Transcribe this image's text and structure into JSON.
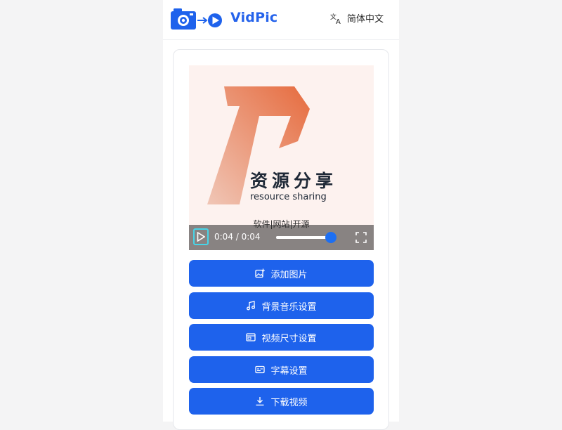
{
  "app": {
    "title": "VidPic",
    "language": "简体中文"
  },
  "video": {
    "brand_cn": "资源分享",
    "brand_en": "resource sharing",
    "brand_sub": "软件|网站|开源",
    "time_display": "0:04 / 0:04",
    "progress": 1.0
  },
  "actions": [
    {
      "label": "添加图片",
      "icon": "add-image-icon"
    },
    {
      "label": "背景音乐设置",
      "icon": "music-note-icon"
    },
    {
      "label": "视频尺寸设置",
      "icon": "aspect-ratio-icon"
    },
    {
      "label": "字幕设置",
      "icon": "subtitles-icon"
    },
    {
      "label": "下载视频",
      "icon": "download-icon"
    }
  ],
  "colors": {
    "accent": "#1e62ec",
    "brand_gradient_start": "#e56a3c",
    "brand_gradient_end": "#f0c3b0",
    "focus_ring": "#47d5e8"
  }
}
